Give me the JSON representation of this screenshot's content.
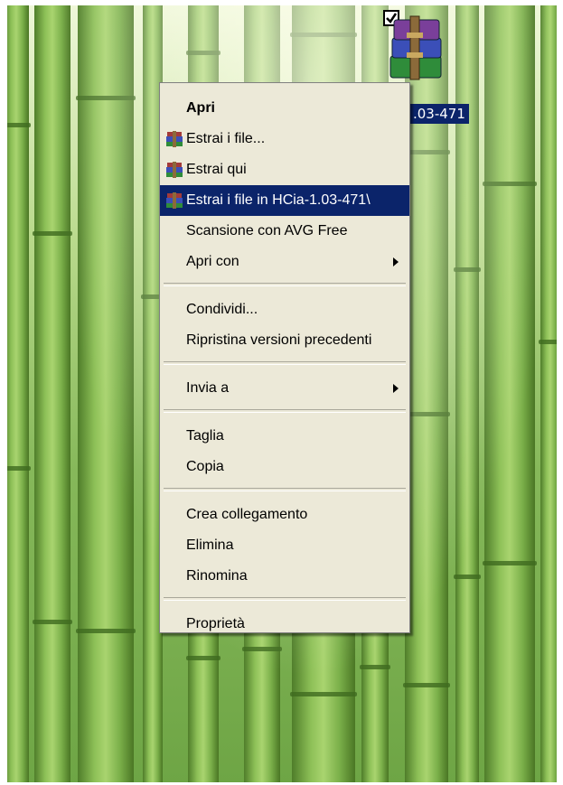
{
  "desktop": {
    "file_label": ".03-471"
  },
  "context_menu": {
    "items": [
      {
        "label": "Apri",
        "default": true
      },
      {
        "label": "Estrai i file...",
        "icon": "winrar-icon"
      },
      {
        "label": "Estrai qui",
        "icon": "winrar-icon"
      },
      {
        "label": "Estrai i file in HCia-1.03-471\\",
        "icon": "winrar-icon",
        "highlighted": true
      },
      {
        "label": "Scansione con AVG Free"
      },
      {
        "label": "Apri con",
        "submenu": true
      },
      {
        "label": "Condividi..."
      },
      {
        "label": "Ripristina versioni precedenti"
      },
      {
        "label": "Invia a",
        "submenu": true
      },
      {
        "label": "Taglia"
      },
      {
        "label": "Copia"
      },
      {
        "label": "Crea collegamento"
      },
      {
        "label": "Elimina"
      },
      {
        "label": "Rinomina"
      },
      {
        "label": "Proprietà"
      }
    ]
  },
  "colors": {
    "menu_background": "#ece9d8",
    "selection": "#0b246a"
  }
}
